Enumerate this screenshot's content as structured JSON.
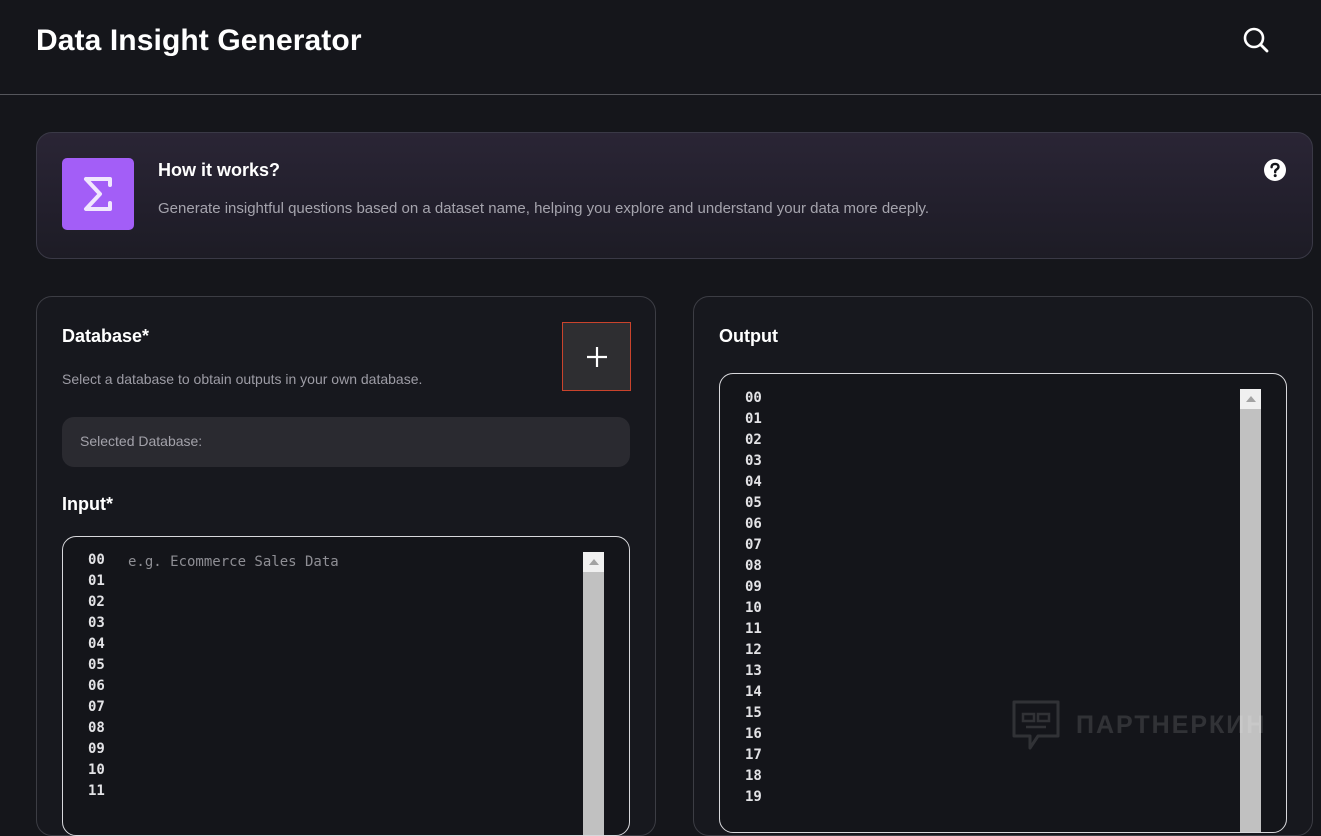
{
  "header": {
    "title": "Data Insight Generator",
    "search_icon": "search-icon"
  },
  "info": {
    "icon": "sigma-icon",
    "title": "How it works?",
    "description": "Generate insightful questions based on a dataset name, helping you explore and understand your data more deeply.",
    "help_icon": "question-circle-icon",
    "accent_color": "#a35ef7"
  },
  "database": {
    "label": "Database*",
    "hint": "Select a database to obtain outputs in your own database.",
    "add_icon": "plus-icon",
    "selected_label": "Selected Database:"
  },
  "input": {
    "label": "Input*",
    "placeholder": "e.g. Ecommerce Sales Data",
    "line_numbers": [
      "00",
      "01",
      "02",
      "03",
      "04",
      "05",
      "06",
      "07",
      "08",
      "09",
      "10",
      "11"
    ]
  },
  "output": {
    "label": "Output",
    "line_numbers": [
      "00",
      "01",
      "02",
      "03",
      "04",
      "05",
      "06",
      "07",
      "08",
      "09",
      "10",
      "11",
      "12",
      "13",
      "14",
      "15",
      "16",
      "17",
      "18",
      "19"
    ]
  },
  "watermark": {
    "text": "ПАРТНЕРКИН"
  }
}
